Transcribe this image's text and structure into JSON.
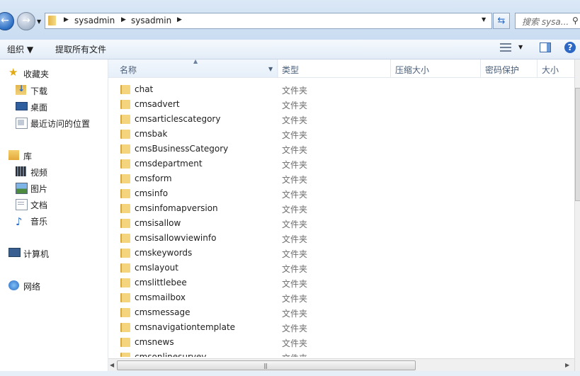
{
  "address": {
    "crumbs": [
      "sysadmin",
      "sysadmin"
    ],
    "search_placeholder": "搜索 sysa..."
  },
  "toolbar": {
    "organize_label": "组织 ▼",
    "extract_label": "提取所有文件"
  },
  "nav": {
    "favorites": {
      "label": "收藏夹",
      "items": [
        "下载",
        "桌面",
        "最近访问的位置"
      ]
    },
    "library": {
      "label": "库",
      "items": [
        "视频",
        "图片",
        "文档",
        "音乐"
      ]
    },
    "computer": "计算机",
    "network": "网络"
  },
  "columns": [
    "名称",
    "类型",
    "压缩大小",
    "密码保护",
    "大小"
  ],
  "files": [
    {
      "name": "chat",
      "type": "文件夹"
    },
    {
      "name": "cmsadvert",
      "type": "文件夹"
    },
    {
      "name": "cmsarticlescategory",
      "type": "文件夹"
    },
    {
      "name": "cmsbak",
      "type": "文件夹"
    },
    {
      "name": "cmsBusinessCategory",
      "type": "文件夹"
    },
    {
      "name": "cmsdepartment",
      "type": "文件夹"
    },
    {
      "name": "cmsform",
      "type": "文件夹"
    },
    {
      "name": "cmsinfo",
      "type": "文件夹"
    },
    {
      "name": "cmsinfomapversion",
      "type": "文件夹"
    },
    {
      "name": "cmsisallow",
      "type": "文件夹"
    },
    {
      "name": "cmsisallowviewinfo",
      "type": "文件夹"
    },
    {
      "name": "cmskeywords",
      "type": "文件夹"
    },
    {
      "name": "cmslayout",
      "type": "文件夹"
    },
    {
      "name": "cmslittlebee",
      "type": "文件夹"
    },
    {
      "name": "cmsmailbox",
      "type": "文件夹"
    },
    {
      "name": "cmsmessage",
      "type": "文件夹"
    },
    {
      "name": "cmsnavigationtemplate",
      "type": "文件夹"
    },
    {
      "name": "cmsnews",
      "type": "文件夹"
    },
    {
      "name": "cmsonlinesurvey",
      "type": "文件夹"
    }
  ]
}
